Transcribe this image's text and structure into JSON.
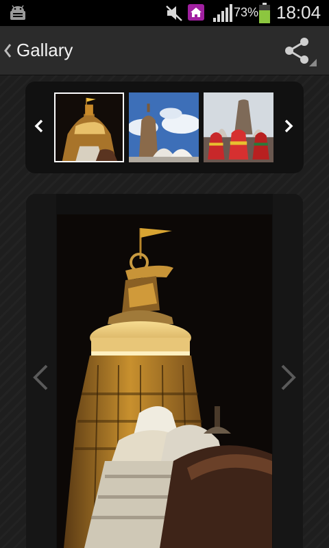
{
  "status_bar": {
    "battery_percent": "73%",
    "time": "18:04",
    "icons": [
      "android-debug-icon",
      "mute-icon",
      "home-app-icon",
      "signal-icon",
      "battery-icon"
    ]
  },
  "action_bar": {
    "title": "Gallary",
    "icons": [
      "back-chevron-icon",
      "share-icon"
    ]
  },
  "thumbnails": {
    "selected_index": 0,
    "items": [
      "temple-night-thumbnail",
      "temple-daytime-thumbnail",
      "chariots-festival-thumbnail"
    ],
    "nav_icons": [
      "chevron-left-icon",
      "chevron-right-icon"
    ]
  },
  "viewer": {
    "image": "temple-night-photo",
    "nav_icons": [
      "chevron-left-icon",
      "chevron-right-icon"
    ]
  },
  "colors": {
    "status_bar_bg": "#000000",
    "action_bar_bg": "#2b2b2b",
    "panel_bg": "#111111",
    "battery_green": "#8cc63f",
    "home_icon_purple": "#a020a0"
  }
}
